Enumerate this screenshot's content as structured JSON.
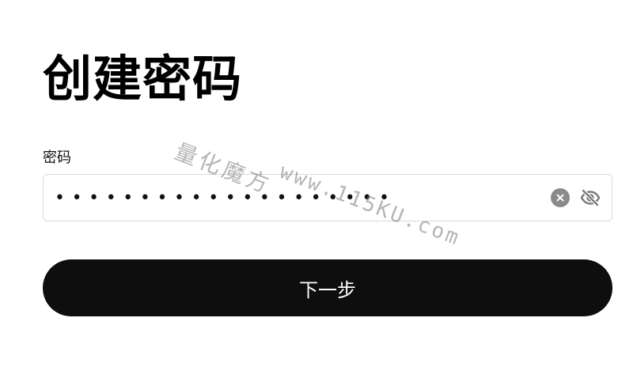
{
  "page": {
    "title": "创建密码"
  },
  "password_field": {
    "label": "密码",
    "masked_value": "••••••••••••••••••••"
  },
  "actions": {
    "next_label": "下一步"
  },
  "watermark": {
    "line1": "量化魔方",
    "line2": "www.115KU.com"
  },
  "icons": {
    "clear": "clear-circle-icon",
    "visibility": "eye-slash-icon"
  },
  "colors": {
    "button_bg": "#0e0e0e",
    "button_text": "#ffffff",
    "input_border": "#d9d9d9",
    "clear_icon_bg": "#8a8a8a",
    "text": "#111111"
  }
}
